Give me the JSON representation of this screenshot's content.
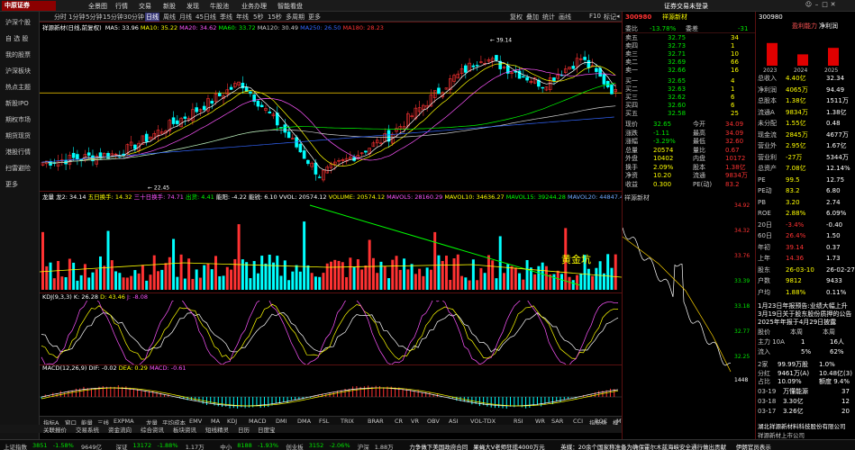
{
  "top_menu": {
    "logo": "中原证券",
    "items": [
      "全景图",
      "行情",
      "交易",
      "新股",
      "发现",
      "牛股池",
      "业务办理",
      "智能看盘"
    ],
    "right_text": "证券交易未登录",
    "right_icons": [
      "gear-icon",
      "user-icon",
      "minimize-icon",
      "maximize-icon",
      "close-icon"
    ]
  },
  "toolbar": {
    "periods": [
      "分时",
      "1分钟",
      "5分钟",
      "15分钟",
      "30分钟",
      "日线",
      "周线",
      "月线",
      "45日线",
      "季线",
      "年线",
      "5秒",
      "15秒",
      "多周期",
      "更多"
    ],
    "active_period": "日线",
    "tools": [
      "复权",
      "叠加",
      "统计",
      "画线",
      "F10",
      "标记",
      "◂"
    ]
  },
  "sidebar": {
    "items": [
      "沪深个股",
      "自 选 股",
      "我的股票",
      "沪深板块",
      "热点主题",
      "新股IPO",
      "期权市场",
      "期货现货",
      "港股行情",
      "扫雷避险",
      "更多"
    ]
  },
  "main_chart": {
    "title": "祥源新材(日线,前复权)",
    "ma_labels": [
      {
        "text": "MA5: 33.96",
        "color": "#ffffff"
      },
      {
        "text": "MA10: 35.22",
        "color": "#ffff00"
      },
      {
        "text": "MA20: 34.62",
        "color": "#ff55ff"
      },
      {
        "text": "MA60: 33.72",
        "color": "#00ff00"
      },
      {
        "text": "MA120: 30.49",
        "color": "#cfcfcf"
      },
      {
        "text": "MA250: 26.50",
        "color": "#3366ff"
      },
      {
        "text": "MA180: 28.23",
        "color": "#ff3333"
      }
    ],
    "high_label": "39.14",
    "low_label": "22.45"
  },
  "volume_panel": {
    "label": "龙量",
    "legend": [
      {
        "text": "龙量  龙2: 34.14",
        "color": "#ffffff"
      },
      {
        "text": "五日换手: 14.32",
        "color": "#ffff00"
      },
      {
        "text": "三十日换手: 74.71",
        "color": "#ff55ff"
      },
      {
        "text": "出货: 4.41",
        "color": "#00ff00"
      },
      {
        "text": "能阳: -4.22",
        "color": "#ffffff"
      },
      {
        "text": "能锐: 6.10",
        "color": "#ffffff"
      },
      {
        "text": "VVOL: 20574.12",
        "color": "#ffffff"
      },
      {
        "text": "VOLUME: 20574.12",
        "color": "#ffff00"
      },
      {
        "text": "MAVOL5: 28160.29",
        "color": "#ff55ff"
      },
      {
        "text": "MAVOL10: 34636.27",
        "color": "#ffff00"
      },
      {
        "text": "MAVOL15: 39244.28",
        "color": "#00ff00"
      },
      {
        "text": "MAVOL20: 44847.44",
        "color": "#6fa8ff"
      }
    ],
    "annotation": "黄金坑",
    "ribbon_label": "蓝色趋势"
  },
  "kdj_panel": {
    "legend": [
      {
        "text": "KDJ(9,3,3)",
        "color": "#ffffff"
      },
      {
        "text": "K: 26.28",
        "color": "#ffffff"
      },
      {
        "text": "D: 43.46",
        "color": "#ffff00"
      },
      {
        "text": "J: -8.08",
        "color": "#ff55ff"
      }
    ]
  },
  "macd_panel": {
    "legend": [
      {
        "text": "MACD(12,26,9)",
        "color": "#ffffff"
      },
      {
        "text": "DIF: -0.02",
        "color": "#ffffff"
      },
      {
        "text": "DEA: 0.29",
        "color": "#ffff00"
      },
      {
        "text": "MACD: -0.61",
        "color": "#ff55ff"
      }
    ]
  },
  "price_axis": [
    "39.00",
    "37.00",
    "35.00",
    "33.00",
    "31.00",
    "29.00",
    "27.00",
    "25.00",
    "23.00"
  ],
  "vol_axis": [
    "25000",
    "20000",
    "15000",
    "10000",
    "5000"
  ],
  "kdj_axis": [
    "100",
    "50",
    "0"
  ],
  "macd_axis": [
    "2.00",
    "1.00",
    "0.00",
    "-1.00"
  ],
  "date_axis": [
    "2025年",
    "03",
    "04",
    "05",
    "06",
    "07",
    "08",
    "09",
    "10",
    "11",
    "12",
    "2026",
    "02",
    "03"
  ],
  "indicator_tabs": [
    "指标A",
    "窗口",
    "能量",
    "三线",
    "EXPMA",
    "龙量",
    "平均成本",
    "EMV",
    "MA",
    "KDJ",
    "MACD",
    "DMI",
    "DMA",
    "FSL",
    "TRIX",
    "BRAR",
    "CR",
    "VR",
    "OBV",
    "ASI",
    "VOL-TDX",
    "RSI",
    "WR",
    "SAR",
    "CCI",
    "ROC",
    "MTM",
    "BOLL",
    "PSY",
    "MCST",
    "龙线",
    "指标"
  ],
  "indicator_tabs_right": [
    "指标组",
    "模",
    "板"
  ],
  "fn_tabs": [
    "关联报价",
    "交易系统",
    "资金流向",
    "综合资讯",
    "板块资讯",
    "短线精灵",
    "日历",
    "日度宝"
  ],
  "quote": {
    "code": "300980",
    "name": "祥源新材",
    "wei_bi": {
      "label": "委比",
      "value": "-13.78%",
      "diff_label": "委差",
      "diff": "-31"
    },
    "asks": [
      {
        "label": "卖五",
        "price": "32.75",
        "vol": "34"
      },
      {
        "label": "卖四",
        "price": "32.73",
        "vol": "1"
      },
      {
        "label": "卖三",
        "price": "32.71",
        "vol": "10"
      },
      {
        "label": "卖二",
        "price": "32.69",
        "vol": "66"
      },
      {
        "label": "卖一",
        "price": "32.66",
        "vol": "16"
      }
    ],
    "bids": [
      {
        "label": "买一",
        "price": "32.65",
        "vol": "4"
      },
      {
        "label": "买二",
        "price": "32.63",
        "vol": "1"
      },
      {
        "label": "买三",
        "price": "32.62",
        "vol": "6"
      },
      {
        "label": "买四",
        "price": "32.60",
        "vol": "6"
      },
      {
        "label": "买五",
        "price": "32.58",
        "vol": "25"
      }
    ],
    "stats": [
      {
        "l1": "现价",
        "v1": "32.65",
        "l2": "今开",
        "v2": "34.09"
      },
      {
        "l1": "涨跌",
        "v1": "-1.11",
        "l2": "最高",
        "v2": "34.09"
      },
      {
        "l1": "涨幅",
        "v1": "-3.29%",
        "l2": "最低",
        "v2": "32.60"
      },
      {
        "l1": "总量",
        "v1": "20574",
        "l2": "量比",
        "v2": "0.67"
      },
      {
        "l1": "外盘",
        "v1": "10402",
        "l2": "内盘",
        "v2": "10172"
      },
      {
        "l1": "换手",
        "v1": "2.09%",
        "l2": "股本",
        "v2": "1.38亿"
      },
      {
        "l1": "净资",
        "v1": "10.20",
        "l2": "流通",
        "v2": "9834万"
      },
      {
        "l1": "收益",
        "v1": "0.300",
        "l2": "PE(动)",
        "v2": "83.2"
      }
    ],
    "mini_chart_title": "祥源新材",
    "mini_axis": [
      "34.92",
      "34.32",
      "33.76",
      "33.39",
      "33.18",
      "32.77",
      "32.25"
    ]
  },
  "far_right": {
    "code": "300980",
    "tabs": [
      "盈利能力",
      "净利润",
      "指标"
    ],
    "active_tab": "净利润",
    "year_labels": [
      "2023",
      "2024",
      "2025"
    ],
    "bar_values": [
      0.7,
      0.35,
      0.55
    ],
    "metrics": [
      {
        "label": "总收入",
        "value": "4.40亿",
        "value2": "32.34"
      },
      {
        "label": "净利润",
        "value": "4065万",
        "value2": "94.49"
      },
      {
        "label": "总股本",
        "value": "1.38亿",
        "value2": "1511万"
      },
      {
        "label": "流通A",
        "value": "9834万",
        "value2": "1.38亿"
      },
      {
        "label": "未分配",
        "value": "1.55亿",
        "value2": "0.48"
      },
      {
        "label": "现金流",
        "value": "2845万",
        "value2": "4677万"
      },
      {
        "label": "营业外",
        "value": "2.95亿",
        "value2": "1.67亿"
      },
      {
        "label": "营业利",
        "value": "-27万",
        "value2": "5344万"
      },
      {
        "label": "总资产",
        "value": "7.08亿",
        "value2": "12.14%"
      },
      {
        "label": "PE",
        "value": "99.5",
        "value2": "12.75"
      },
      {
        "label": "PE动",
        "value": "83.2",
        "value2": "6.80"
      },
      {
        "label": "PB",
        "value": "3.20",
        "value2": "2.74"
      },
      {
        "label": "ROE",
        "value": "2.88%",
        "value2": "6.09%"
      },
      {
        "label": "20日",
        "value": "-3.4%",
        "value2": "-0.40"
      },
      {
        "label": "60日",
        "value": "26.4%",
        "value2": "1.50"
      },
      {
        "label": "年初",
        "value": "39.14",
        "value2": "0.37"
      },
      {
        "label": "上年",
        "value": "14.36",
        "value2": "1.73"
      },
      {
        "label": "股东",
        "value": "26-03-10",
        "value2": "26-02-27"
      },
      {
        "label": "户数",
        "value": "9812",
        "value2": "9433"
      },
      {
        "label": "户均",
        "value": "1.88%",
        "value2": "0.11%"
      }
    ],
    "news": [
      "1月23日年报预告:业绩大幅上升",
      "3月19日关于股东股份质押的公告",
      "2025年年报于4月29日披露"
    ],
    "flow_header": [
      "股价",
      "本周",
      "本周"
    ],
    "flow_rows": [
      {
        "label": "主力 10A",
        "a": "1",
        "b": "16人"
      },
      {
        "label": "流入",
        "a": "5%",
        "b": "62%"
      }
    ],
    "holder_rows": [
      {
        "label": "2家",
        "v1": "99.99万股",
        "v2": "1.0%"
      },
      {
        "label": "分红",
        "v1": "9461万(A)",
        "v2": "10.48亿(3)"
      },
      {
        "label": "占比",
        "v1": "10.09%",
        "v2": "额度 9.4%"
      }
    ],
    "trade_rows": [
      {
        "date": "03-19",
        "name": "万懂能源",
        "val": "37"
      },
      {
        "date": "03-18",
        "name": "3.30亿",
        "val": "12"
      },
      {
        "date": "03-17",
        "name": "3.26亿",
        "val": "20"
      }
    ],
    "company": "湖北祥源新材料科技股份有限公司",
    "company2": "祥源新材上市公司"
  },
  "mini_chart_foot": "1448",
  "status_bar": [
    {
      "text": "上证指数",
      "color": "#c8c8c8"
    },
    {
      "text": "3851",
      "color": "#00e600"
    },
    {
      "text": "-1.58%",
      "color": "#00e600"
    },
    {
      "text": "9649亿",
      "color": "#c8c8c8"
    },
    {
      "text": "深证",
      "color": "#c8c8c8"
    },
    {
      "text": "13172",
      "color": "#00e600"
    },
    {
      "text": "-1.88%",
      "color": "#00e600"
    },
    {
      "text": "1.17万",
      "color": "#c8c8c8"
    },
    {
      "text": "中小",
      "color": "#c8c8c8"
    },
    {
      "text": "8188",
      "color": "#00e600"
    },
    {
      "text": "-1.93%",
      "color": "#00e600"
    },
    {
      "text": "创业板",
      "color": "#c8c8c8"
    },
    {
      "text": "3152",
      "color": "#00e600"
    },
    {
      "text": "-2.06%",
      "color": "#00e600"
    },
    {
      "text": "沪深",
      "color": "#c8c8c8"
    },
    {
      "text": "1.88万",
      "color": "#c8c8c8"
    },
    {
      "text": "力争做下美国政府合同",
      "color": "#ffffff"
    },
    {
      "text": "果蝇大V老师狂揽4000万元",
      "color": "#ffffff"
    },
    {
      "text": "英媒：20余个国家称准备为确保霍尔木兹海峡安全通行做出贡献",
      "color": "#ffffff"
    },
    {
      "text": "伊朗官员表示",
      "color": "#ffffff"
    }
  ],
  "colors": {
    "up": "#ff3232",
    "down": "#00ffff",
    "panel_border": "#5a1010"
  }
}
